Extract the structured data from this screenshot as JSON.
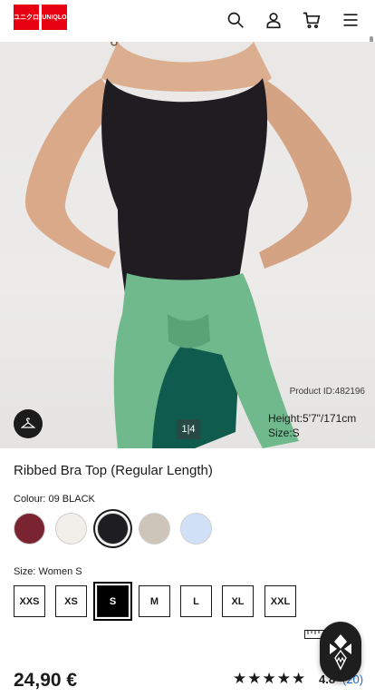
{
  "header": {
    "logo_top": "ユニクロ",
    "logo_bottom": "UNIQLO",
    "icons": [
      "search-icon",
      "account-icon",
      "cart-icon",
      "menu-icon"
    ]
  },
  "hero": {
    "product_id": "Product ID:482196",
    "model_height": "Height:5'7\"/171cm",
    "model_size": "Size:S",
    "pager": "1|4"
  },
  "product": {
    "title": "Ribbed Bra Top (Regular Length)",
    "colour_label": "Colour: 09 BLACK",
    "colours": [
      {
        "name": "wine",
        "hex": "#7a2431"
      },
      {
        "name": "off-white",
        "hex": "#f1efe9"
      },
      {
        "name": "black",
        "hex": "#1d1d22",
        "selected": true
      },
      {
        "name": "beige",
        "hex": "#cdc6b8"
      },
      {
        "name": "light-blue",
        "hex": "#cfe0f7"
      }
    ],
    "size_label": "Size: Women S",
    "sizes": [
      "XXS",
      "XS",
      "S",
      "M",
      "L",
      "XXL"
    ],
    "sizes_all": [
      "XXS",
      "XS",
      "S",
      "M",
      "L",
      "XL",
      "XXL"
    ],
    "selected_size": "S",
    "price": "24,90 €",
    "stars": "★★★★★",
    "rating": "4.8",
    "reviews": "(20)"
  },
  "colors": {
    "brand_red": "#e60012",
    "link_blue": "#1e6ed4",
    "text": "#1b1b1b"
  }
}
